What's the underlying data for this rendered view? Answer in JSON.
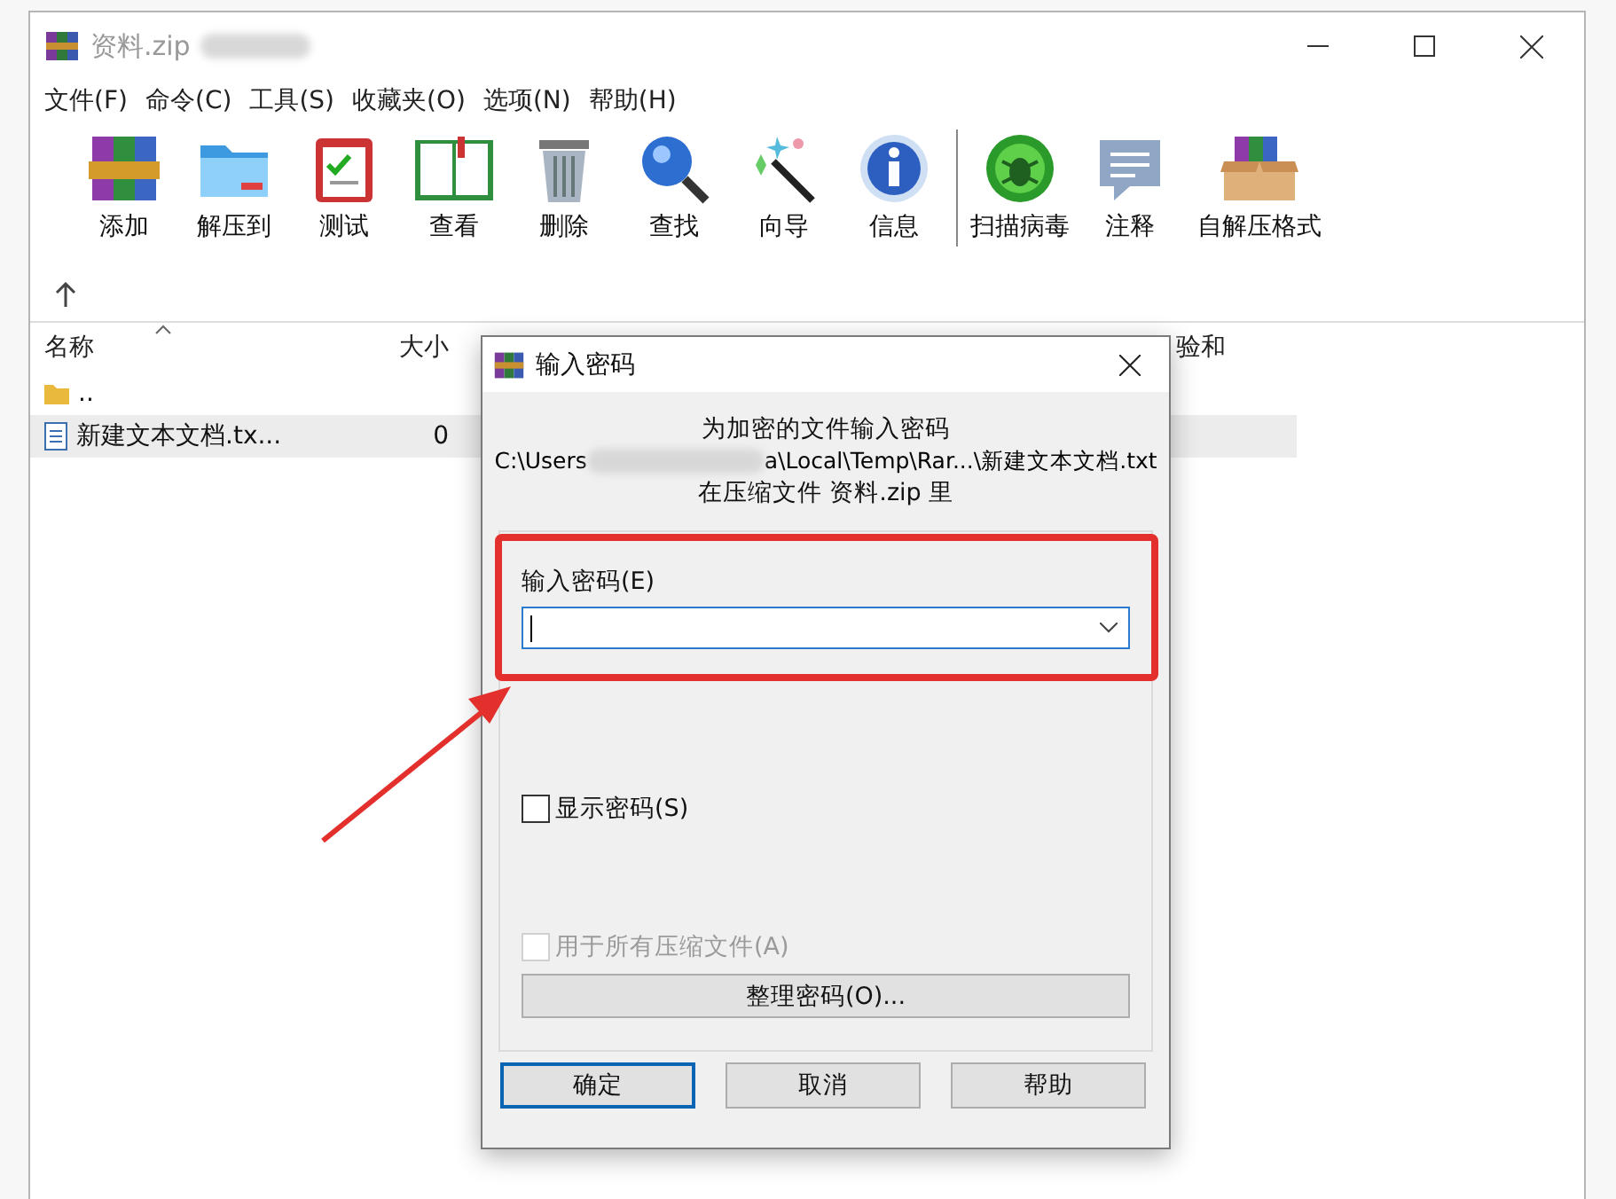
{
  "window": {
    "title": "资料.zip"
  },
  "menu": [
    "文件(F)",
    "命令(C)",
    "工具(S)",
    "收藏夹(O)",
    "选项(N)",
    "帮助(H)"
  ],
  "toolbar": [
    {
      "label": "添加"
    },
    {
      "label": "解压到"
    },
    {
      "label": "测试"
    },
    {
      "label": "查看"
    },
    {
      "label": "删除"
    },
    {
      "label": "查找"
    },
    {
      "label": "向导"
    },
    {
      "label": "信息"
    },
    {
      "label": "扫描病毒"
    },
    {
      "label": "注释"
    },
    {
      "label": "自解压格式"
    }
  ],
  "file_list": {
    "columns": [
      {
        "label": "名称",
        "sorted": true
      },
      {
        "label": "大小",
        "sorted": false
      },
      {
        "label": "验和",
        "sorted": false
      }
    ],
    "rows": [
      {
        "name": "..",
        "kind": "folder",
        "selected": false
      },
      {
        "name": "新建文本文档.tx...",
        "size": "0",
        "kind": "file",
        "selected": true
      }
    ]
  },
  "dialog": {
    "title": "输入密码",
    "message": "为加密的文件输入密码",
    "path_start": "C:\\Users",
    "path_end": "a\\Local\\Temp\\Rar...\\新建文本文档.txt",
    "archive_line": "在压缩文件 资料.zip 里",
    "password_label": "输入密码(E)",
    "checkboxes": [
      {
        "label": "显示密码(S)",
        "checked": false,
        "disabled": false
      },
      {
        "label": "用于所有压缩文件(A)",
        "checked": false,
        "disabled": true
      }
    ],
    "organize_button": "整理密码(O)...",
    "buttons": [
      {
        "label": "确定",
        "default": true
      },
      {
        "label": "取消",
        "default": false
      },
      {
        "label": "帮助",
        "default": false
      }
    ]
  }
}
